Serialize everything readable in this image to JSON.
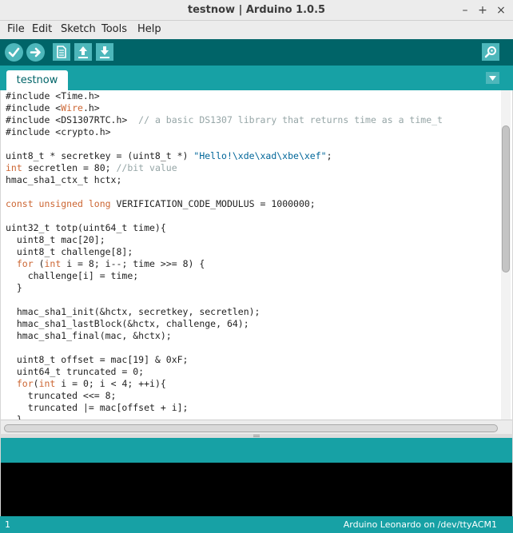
{
  "window": {
    "title": "testnow | Arduino 1.0.5",
    "controls": [
      "–",
      "+",
      "×"
    ]
  },
  "menu": [
    "File",
    "Edit",
    "Sketch",
    "Tools",
    "Help"
  ],
  "toolbar": {
    "buttons": [
      {
        "icon": "verify-check-icon"
      },
      {
        "icon": "upload-arrow-icon"
      },
      {
        "icon": "new-document-icon"
      },
      {
        "icon": "open-arrow-up-icon"
      },
      {
        "icon": "save-arrow-down-icon"
      },
      {
        "icon": "serial-monitor-magnifier-icon"
      }
    ]
  },
  "tabs": [
    {
      "label": "testnow",
      "active": true
    }
  ],
  "editor": {
    "lines": [
      [
        [
          "t",
          "#include <Time.h>"
        ]
      ],
      [
        [
          "t",
          "#include <"
        ],
        [
          "kw",
          "Wire"
        ],
        [
          "t",
          ".h>"
        ]
      ],
      [
        [
          "t",
          "#include <DS1307RTC.h>  "
        ],
        [
          "cm",
          "// a basic DS1307 library that returns time as a time_t"
        ]
      ],
      [
        [
          "t",
          "#include <crypto.h>"
        ]
      ],
      [
        [
          "t",
          ""
        ]
      ],
      [
        [
          "t",
          "uint8_t * secretkey = (uint8_t *) "
        ],
        [
          "str",
          "\"Hello!\\xde\\xad\\xbe\\xef\""
        ],
        [
          "t",
          ";"
        ]
      ],
      [
        [
          "kw",
          "int"
        ],
        [
          "t",
          " secretlen = 80; "
        ],
        [
          "cm",
          "//bit value"
        ]
      ],
      [
        [
          "t",
          "hmac_sha1_ctx_t hctx;"
        ]
      ],
      [
        [
          "t",
          ""
        ]
      ],
      [
        [
          "kw",
          "const unsigned long"
        ],
        [
          "t",
          " VERIFICATION_CODE_MODULUS = 1000000;"
        ]
      ],
      [
        [
          "t",
          ""
        ]
      ],
      [
        [
          "t",
          "uint32_t totp(uint64_t time){"
        ]
      ],
      [
        [
          "t",
          "  uint8_t mac[20];"
        ]
      ],
      [
        [
          "t",
          "  uint8_t challenge[8];"
        ]
      ],
      [
        [
          "t",
          "  "
        ],
        [
          "kw",
          "for"
        ],
        [
          "t",
          " ("
        ],
        [
          "kw",
          "int"
        ],
        [
          "t",
          " i = 8; i--; time >>= 8) {"
        ]
      ],
      [
        [
          "t",
          "    challenge[i] = time;"
        ]
      ],
      [
        [
          "t",
          "  }"
        ]
      ],
      [
        [
          "t",
          ""
        ]
      ],
      [
        [
          "t",
          "  hmac_sha1_init(&hctx, secretkey, secretlen);"
        ]
      ],
      [
        [
          "t",
          "  hmac_sha1_lastBlock(&hctx, challenge, 64);"
        ]
      ],
      [
        [
          "t",
          "  hmac_sha1_final(mac, &hctx);"
        ]
      ],
      [
        [
          "t",
          ""
        ]
      ],
      [
        [
          "t",
          "  uint8_t offset = mac[19] & 0xF;"
        ]
      ],
      [
        [
          "t",
          "  uint64_t truncated = 0;"
        ]
      ],
      [
        [
          "t",
          "  "
        ],
        [
          "kw",
          "for"
        ],
        [
          "t",
          "("
        ],
        [
          "kw",
          "int"
        ],
        [
          "t",
          " i = 0; i < 4; ++i){"
        ]
      ],
      [
        [
          "t",
          "    truncated <<= 8;"
        ]
      ],
      [
        [
          "t",
          "    truncated |= mac[offset + i];"
        ]
      ],
      [
        [
          "t",
          "  }"
        ]
      ]
    ]
  },
  "status": {
    "line_number": "1",
    "board": "Arduino Leonardo on /dev/ttyACM1"
  },
  "colors": {
    "toolbar": "#006468",
    "tabs_bar": "#17a1a5",
    "button": "#4db7bb",
    "keyword": "#cc6633",
    "string": "#006699",
    "comment": "#95a5a6",
    "console": "#000000"
  }
}
